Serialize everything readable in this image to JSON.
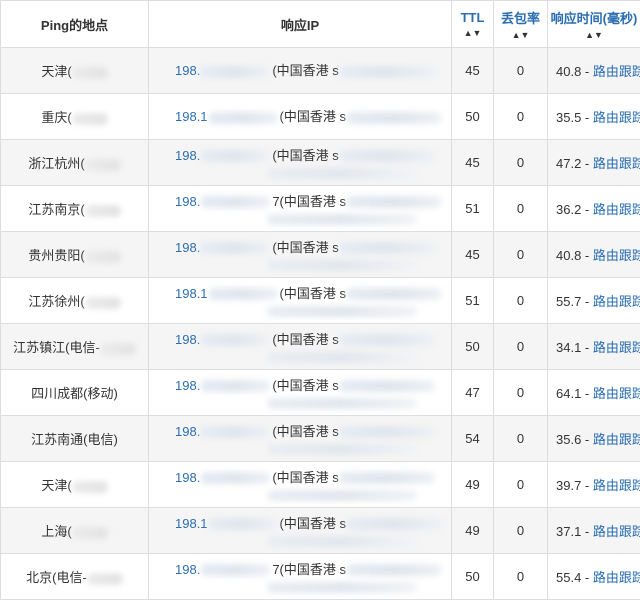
{
  "header": {
    "location": "Ping的地点",
    "ip": "响应IP",
    "ttl": "TTL",
    "loss": "丢包率",
    "time": "响应时间(毫秒)",
    "sort_icon": "▲▼"
  },
  "rows": [
    {
      "location": "天津(",
      "loc_blur": true,
      "ip": "198.",
      "region": "(中国香港 s",
      "extra": false,
      "ttl": "45",
      "loss": "0",
      "time": "40.8",
      "route": "路由跟踪"
    },
    {
      "location": "重庆(",
      "loc_blur": true,
      "ip": "198.1",
      "region": "(中国香港 s",
      "extra": false,
      "ttl": "50",
      "loss": "0",
      "time": "35.5",
      "route": "路由跟踪"
    },
    {
      "location": "浙江杭州(",
      "loc_blur": true,
      "ip": "198.",
      "region": "(中国香港 s",
      "extra": true,
      "ttl": "45",
      "loss": "0",
      "time": "47.2",
      "route": "路由跟踪"
    },
    {
      "location": "江苏南京(",
      "loc_blur": true,
      "ip": "198.",
      "region": "7(中国香港 s",
      "extra": true,
      "ttl": "51",
      "loss": "0",
      "time": "36.2",
      "route": "路由跟踪"
    },
    {
      "location": "贵州贵阳(",
      "loc_blur": true,
      "ip": "198.",
      "region": "(中国香港 s",
      "extra": true,
      "ttl": "45",
      "loss": "0",
      "time": "40.8",
      "route": "路由跟踪"
    },
    {
      "location": "江苏徐州(",
      "loc_blur": true,
      "ip": "198.1",
      "region": "(中国香港 s",
      "extra": true,
      "ttl": "51",
      "loss": "0",
      "time": "55.7",
      "route": "路由跟踪"
    },
    {
      "location": "江苏镇江(电信-",
      "loc_blur": true,
      "ip": "198.",
      "region": "(中国香港 s",
      "extra": true,
      "ttl": "50",
      "loss": "0",
      "time": "34.1",
      "route": "路由跟踪"
    },
    {
      "location": "四川成都(移动)",
      "loc_blur": false,
      "ip": "198.",
      "region": "(中国香港 s",
      "extra": true,
      "ttl": "47",
      "loss": "0",
      "time": "64.1",
      "route": "路由跟踪"
    },
    {
      "location": "江苏南通(电信)",
      "loc_blur": false,
      "ip": "198.",
      "region": "(中国香港 s",
      "extra": true,
      "ttl": "54",
      "loss": "0",
      "time": "35.6",
      "route": "路由跟踪"
    },
    {
      "location": "天津(",
      "loc_blur": true,
      "ip": "198.",
      "region": "(中国香港 s",
      "extra": true,
      "ttl": "49",
      "loss": "0",
      "time": "39.7",
      "route": "路由跟踪"
    },
    {
      "location": "上海(",
      "loc_blur": true,
      "ip": "198.1",
      "region": "(中国香港 s",
      "extra": true,
      "ttl": "49",
      "loss": "0",
      "time": "37.1",
      "route": "路由跟踪"
    },
    {
      "location": "北京(电信-",
      "loc_blur": true,
      "ip": "198.",
      "region": "7(中国香港 s",
      "extra": true,
      "ttl": "50",
      "loss": "0",
      "time": "55.4",
      "route": "路由跟踪"
    }
  ]
}
